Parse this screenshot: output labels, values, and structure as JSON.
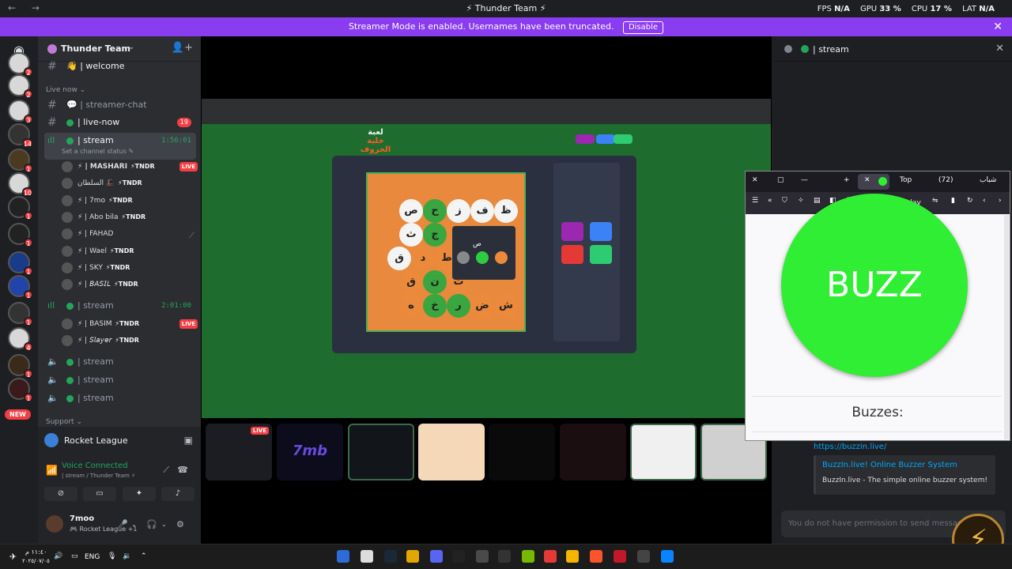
{
  "titlebar": {
    "nav": "← →",
    "title": "⚡ Thunder Team ⚡",
    "fps_label": "FPS",
    "fps_value": "N/A",
    "gpu_label": "GPU",
    "gpu_value": "33 %",
    "cpu_label": "CPU",
    "cpu_value": "17 %",
    "lat_label": "LAT",
    "lat_value": "N/A"
  },
  "banner": {
    "text": "Streamer Mode is enabled. Usernames have been truncated.",
    "button": "Disable",
    "close": "✕"
  },
  "rail": {
    "badges": [
      "2",
      "2",
      "3",
      "14",
      "1",
      "10",
      "1",
      "1",
      "1",
      "1",
      "1",
      "4",
      "1",
      "1"
    ],
    "new": "NEW"
  },
  "guild": {
    "name": "Thunder Team",
    "chev": "⌄",
    "add": "👤+"
  },
  "channels": {
    "welcome": "👋 | welcome",
    "live_now_cat": "Live now ⌄",
    "streamer_chat": "💬 | streamer-chat",
    "live_now": "| live-now",
    "live_now_count": "19",
    "stream1": "| stream",
    "stream1_time": "1:56:01",
    "status": "Set a channel status ✎",
    "stream2": "| stream",
    "stream2_time": "2:01:00",
    "stream3": "| stream",
    "stream4": "| stream",
    "stream5": "| stream",
    "support_cat": "Support ⌄"
  },
  "users1": [
    {
      "name": "⚡ | MASHARI",
      "tag": "⚡TNDR",
      "live": "LIVE"
    },
    {
      "name": "السلطان 🎩",
      "tag": "⚡TNDR",
      "live": ""
    },
    {
      "name": "⚡ | 7mo",
      "tag": "⚡TNDR",
      "live": ""
    },
    {
      "name": "⚡ | Abo bila",
      "tag": "⚡TNDR",
      "live": ""
    },
    {
      "name": "⚡ | FAHAD",
      "tag": "",
      "live": ""
    },
    {
      "name": "⚡ | Wael",
      "tag": "⚡TNDR",
      "live": ""
    },
    {
      "name": "⚡ | SKY",
      "tag": "⚡TNDR",
      "live": ""
    },
    {
      "name": "⚡ | 𝘉𝘈𝘚𝘐𝘓",
      "tag": "⚡TNDR",
      "live": ""
    }
  ],
  "users2": [
    {
      "name": "⚡ | BASIM",
      "tag": "⚡TNDR",
      "live": "LIVE"
    },
    {
      "name": "⚡ | 𝘚𝘭𝘢𝘺𝘦𝘳",
      "tag": "⚡TNDR",
      "live": ""
    }
  ],
  "voice": {
    "activity": "Rocket League",
    "connected": "Voice Connected",
    "sub": "| stream / Thunder Team ⚡",
    "user": "7moo",
    "user_sub": "🎮 Rocket League +1"
  },
  "game": {
    "logo1": "لعبة",
    "logo2": "خلية الحروف",
    "letters": [
      [
        "ظ",
        "ف",
        "ز",
        "ح",
        "ص"
      ],
      [
        "ك",
        "ج",
        "ث"
      ],
      [
        "ط",
        "د",
        "ق"
      ],
      [
        "ت",
        "ن",
        "ق"
      ],
      [
        "ش",
        "ض",
        "ر",
        "خ",
        "ه"
      ]
    ],
    "popup_letter": "ص"
  },
  "stream_tiles": [
    {
      "label": "",
      "live": "LIVE"
    },
    {
      "label": "7mb",
      "live": ""
    },
    {
      "label": "",
      "live": ""
    },
    {
      "label": "",
      "live": ""
    },
    {
      "label": "",
      "live": ""
    },
    {
      "label": "",
      "live": ""
    },
    {
      "label": "",
      "live": ""
    },
    {
      "label": "",
      "live": ""
    }
  ],
  "right": {
    "channel": "| stream",
    "close": "✕",
    "link": "https://buzzin.live/",
    "embed_title": "BuzzIn.live! Online Buzzer System",
    "embed_desc": "BuzzIn.live - The simple online buzzer system!",
    "input": "You do not have permission to send messages in th"
  },
  "firefox": {
    "tab1": "Top",
    "tab2": "(72)",
    "tab3": "شباب",
    "url": "buzzin.live/play",
    "buzz": "BUZZ",
    "buzzes": "Buzzes:"
  },
  "taskbar": {
    "lang": "ENG",
    "time": "١١:٤٠ م",
    "date": "٢٠٢٥/٠٧/٠٥"
  },
  "colors": {
    "accent": "#8a3cf0",
    "green": "#23a55a",
    "red": "#f23f43",
    "buzz": "#30ee34"
  }
}
